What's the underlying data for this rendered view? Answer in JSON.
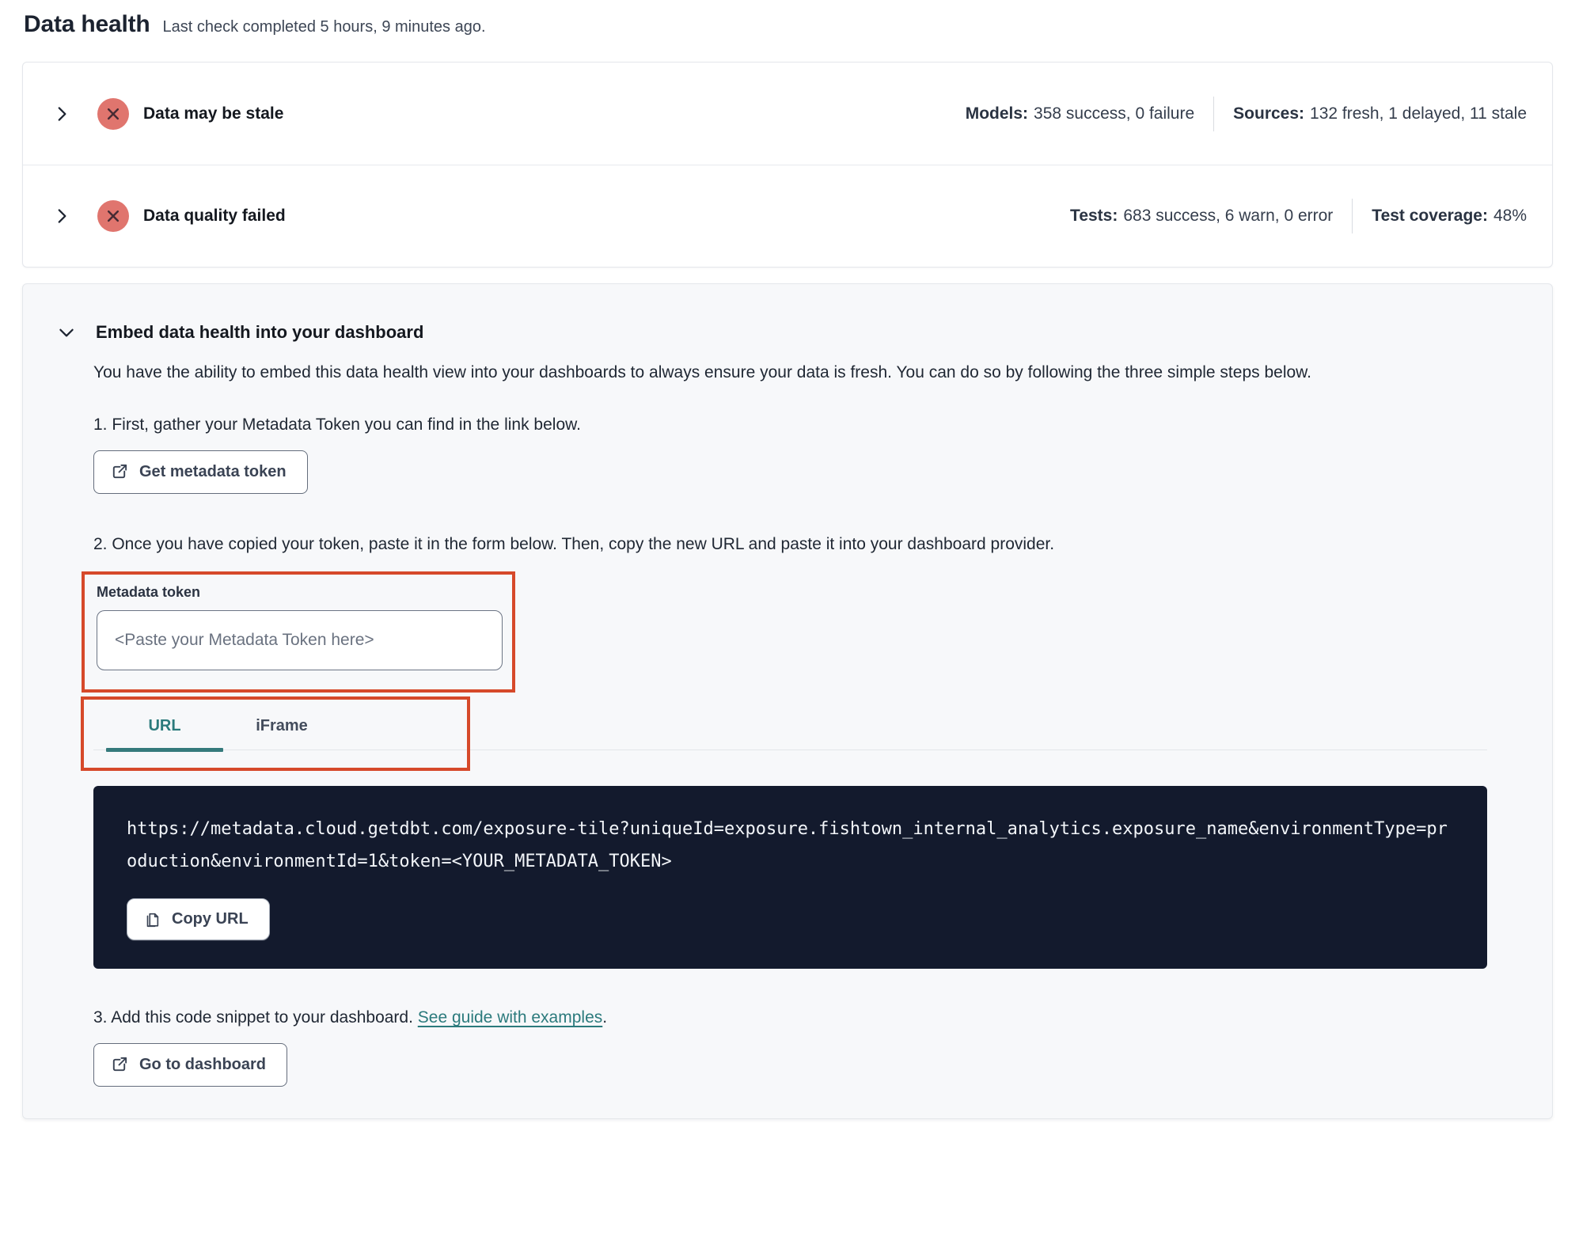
{
  "page": {
    "title": "Data health",
    "subtitle": "Last check completed 5 hours, 9 minutes ago."
  },
  "status_rows": [
    {
      "title": "Data may be stale",
      "status": "error",
      "stats": [
        {
          "label": "Models:",
          "value": "358 success, 0 failure"
        },
        {
          "label": "Sources:",
          "value": "132 fresh, 1 delayed, 11 stale"
        }
      ]
    },
    {
      "title": "Data quality failed",
      "status": "error",
      "stats": [
        {
          "label": "Tests:",
          "value": "683 success, 6 warn, 0 error"
        },
        {
          "label": "Test coverage:",
          "value": "48%"
        }
      ]
    }
  ],
  "embed": {
    "heading": "Embed data health into your dashboard",
    "description": "You have the ability to embed this data health view into your dashboards to always ensure your data is fresh. You can do so by following the three simple steps below.",
    "step1": "1. First, gather your Metadata Token you can find in the link below.",
    "get_token_button": "Get metadata token",
    "step2": "2. Once you have copied your token, paste it in the form below. Then, copy the new URL and paste it into your dashboard provider.",
    "token_field": {
      "label": "Metadata token",
      "value": "",
      "placeholder": "<Paste your Metadata Token here>"
    },
    "tabs": [
      {
        "label": "URL",
        "active": true
      },
      {
        "label": "iFrame",
        "active": false
      }
    ],
    "code_url": "https://metadata.cloud.getdbt.com/exposure-tile?uniqueId=exposure.fishtown_internal_analytics.exposure_name&environmentType=production&environmentId=1&token=<YOUR_METADATA_TOKEN>",
    "copy_button": "Copy URL",
    "step3_prefix": "3. Add this code snippet to your dashboard. ",
    "step3_link": "See guide with examples",
    "step3_suffix": ".",
    "dashboard_button": "Go to dashboard"
  },
  "colors": {
    "accent_teal": "#2b7a7c",
    "error_badge_bg": "#e0756e",
    "error_badge_glyph": "#472b34",
    "annotation_red": "#d6492a",
    "code_block_bg": "#131a2d",
    "card_bg": "#f7f8fa"
  }
}
